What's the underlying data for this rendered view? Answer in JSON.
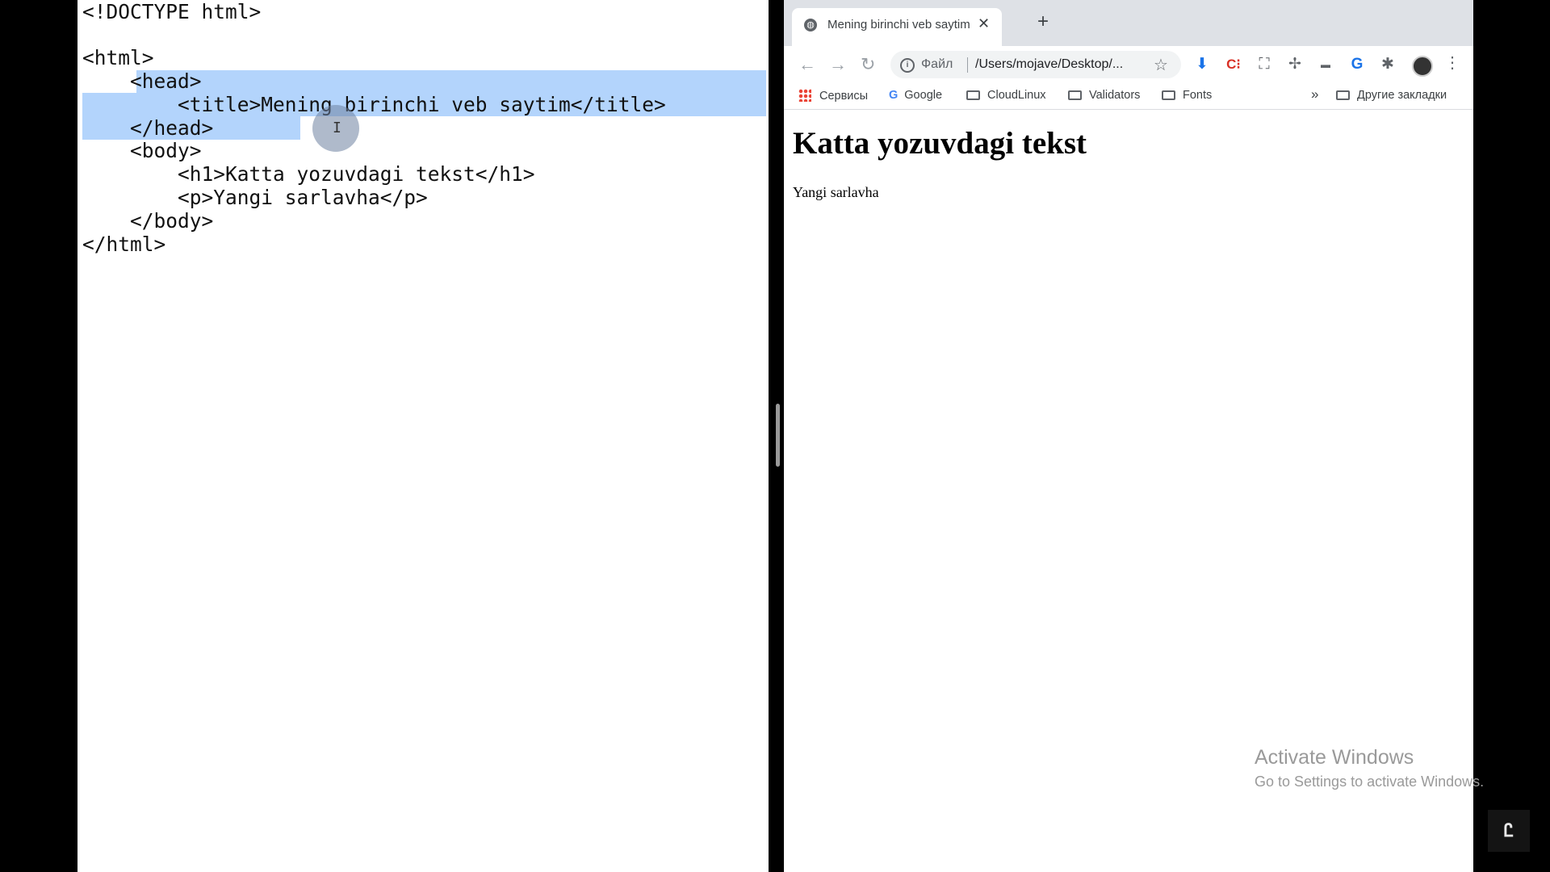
{
  "editor": {
    "lines": [
      "<!DOCTYPE html>",
      "",
      "<html>",
      "    <head>",
      "        <title>Mening birinchi veb saytim</title>",
      "    </head>",
      "    <body>",
      "        <h1>Katta yozuvdagi tekst</h1>",
      "        <p>Yangi sarlavha</p>",
      "    </body>",
      "</html>"
    ],
    "cursor_glyph": "I"
  },
  "browser": {
    "tab_title": "Mening birinchi veb saytim",
    "tab_close": "✕",
    "new_tab": "+",
    "nav": {
      "back": "←",
      "forward": "→",
      "reload": "↻"
    },
    "omnibox": {
      "info": "i",
      "scheme_label": "Файл",
      "url": "/Users/mojave/Desktop/...",
      "star": "☆"
    },
    "extensions": [
      "⬇",
      "C⁝",
      "⛶",
      "✢",
      "▬",
      "G",
      "✱"
    ],
    "menu": "⋮",
    "bookmarks": {
      "apps_label": "Сервисы",
      "google": "Google",
      "google_icon": "G",
      "items": [
        "CloudLinux",
        "Validators",
        "Fonts"
      ],
      "overflow": "»",
      "other_label": "Другие закладки"
    },
    "page": {
      "h1": "Katta yozuvdagi tekst",
      "p": "Yangi sarlavha"
    }
  },
  "overlay": {
    "activate_title": "Activate Windows",
    "activate_sub": "Go to Settings to activate Windows.",
    "watermark": "Ꮭ"
  },
  "colors": {
    "selection": "#b3d4fc",
    "tabstrip": "#dee1e6",
    "download_icon": "#1a73e8",
    "ext_red": "#d93025"
  }
}
